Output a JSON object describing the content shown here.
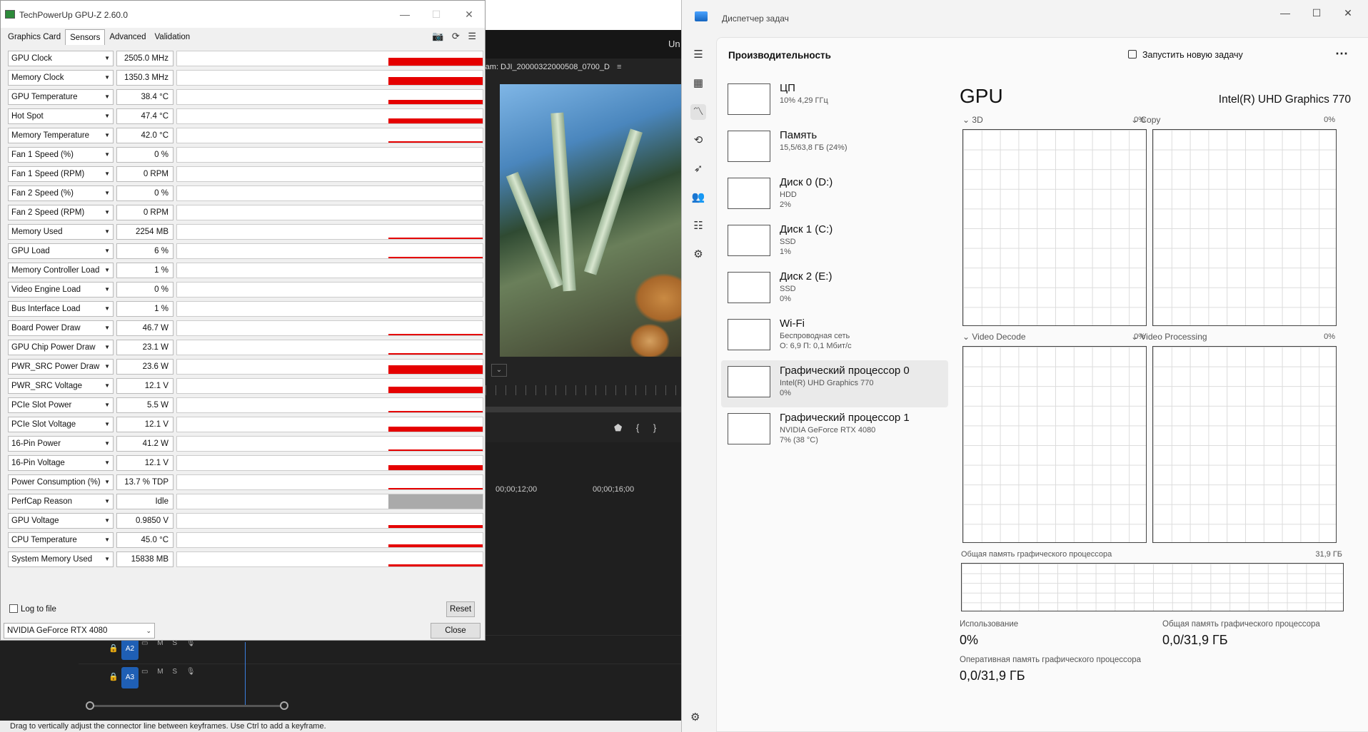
{
  "premiere": {
    "title_fragment": "Un",
    "program_tab": "ram: DJI_20000322000508_0700_D",
    "program_menu": "≡",
    "marker_buttons": "⬟ { }",
    "timecodes": [
      "00;00;12;00",
      "00;00;16;00"
    ],
    "track_labels": [
      "A2",
      "A3"
    ],
    "track_controls": "M S",
    "status_bar": "Drag to vertically adjust the connector line between keyframes. Use Ctrl to add a keyframe."
  },
  "gpuz": {
    "title": "TechPowerUp GPU-Z 2.60.0",
    "tabs": [
      "Graphics Card",
      "Sensors",
      "Advanced",
      "Validation"
    ],
    "active_tab": "Sensors",
    "sensors": [
      {
        "name": "GPU Clock",
        "value": "2505.0 MHz",
        "level": 0.55
      },
      {
        "name": "Memory Clock",
        "value": "1350.3 MHz",
        "level": 0.55
      },
      {
        "name": "GPU Temperature",
        "value": "38.4 °C",
        "level": 0.3
      },
      {
        "name": "Hot Spot",
        "value": "47.4 °C",
        "level": 0.35
      },
      {
        "name": "Memory Temperature",
        "value": "42.0 °C",
        "level": 0.12
      },
      {
        "name": "Fan 1 Speed (%)",
        "value": "0 %",
        "level": 0
      },
      {
        "name": "Fan 1 Speed (RPM)",
        "value": "0 RPM",
        "level": 0
      },
      {
        "name": "Fan 2 Speed (%)",
        "value": "0 %",
        "level": 0
      },
      {
        "name": "Fan 2 Speed (RPM)",
        "value": "0 RPM",
        "level": 0
      },
      {
        "name": "Memory Used",
        "value": "2254 MB",
        "level": 0.1
      },
      {
        "name": "GPU Load",
        "value": "6 %",
        "level": 0.06
      },
      {
        "name": "Memory Controller Load",
        "value": "1 %",
        "level": 0
      },
      {
        "name": "Video Engine Load",
        "value": "0 %",
        "level": 0
      },
      {
        "name": "Bus Interface Load",
        "value": "1 %",
        "level": 0
      },
      {
        "name": "Board Power Draw",
        "value": "46.7 W",
        "level": 0.1
      },
      {
        "name": "GPU Chip Power Draw",
        "value": "23.1 W",
        "level": 0.1
      },
      {
        "name": "PWR_SRC Power Draw",
        "value": "23.6 W",
        "level": 0.6
      },
      {
        "name": "PWR_SRC Voltage",
        "value": "12.1 V",
        "level": 0.45
      },
      {
        "name": "PCIe Slot Power",
        "value": "5.5 W",
        "level": 0.08
      },
      {
        "name": "PCIe Slot Voltage",
        "value": "12.1 V",
        "level": 0.35
      },
      {
        "name": "16-Pin Power",
        "value": "41.2 W",
        "level": 0.1
      },
      {
        "name": "16-Pin Voltage",
        "value": "12.1 V",
        "level": 0.35
      },
      {
        "name": "Power Consumption (%)",
        "value": "13.7 % TDP",
        "level": 0.1
      },
      {
        "name": "PerfCap Reason",
        "value": "Idle",
        "level": 1.0,
        "gray": true
      },
      {
        "name": "GPU Voltage",
        "value": "0.9850 V",
        "level": 0.2
      },
      {
        "name": "CPU Temperature",
        "value": "45.0 °C",
        "level": 0.2
      },
      {
        "name": "System Memory Used",
        "value": "15838 MB",
        "level": 0.15
      }
    ],
    "log_to_file": "Log to file",
    "reset_label": "Reset",
    "close_label": "Close",
    "gpu_selected": "NVIDIA GeForce RTX 4080",
    "graph_color": "#e50000"
  },
  "taskmgr": {
    "title": "Диспетчер задач",
    "page_title": "Производительность",
    "run_new_task": "Запустить новую задачу",
    "resources": [
      {
        "name": "ЦП",
        "sub": [
          "10% 4,29 ГГц"
        ]
      },
      {
        "name": "Память",
        "sub": [
          "15,5/63,8 ГБ (24%)"
        ]
      },
      {
        "name": "Диск 0 (D:)",
        "sub": [
          "HDD",
          "2%"
        ]
      },
      {
        "name": "Диск 1 (C:)",
        "sub": [
          "SSD",
          "1%"
        ]
      },
      {
        "name": "Диск 2 (E:)",
        "sub": [
          "SSD",
          "0%"
        ]
      },
      {
        "name": "Wi-Fi",
        "sub": [
          "Беспроводная сеть",
          "О: 6,9 П: 0,1 Мбит/с"
        ]
      },
      {
        "name": "Графический процессор 0",
        "sub": [
          "Intel(R) UHD Graphics 770",
          "0%"
        ]
      },
      {
        "name": "Графический процессор 1",
        "sub": [
          "NVIDIA GeForce RTX 4080",
          "7% (38 °C)"
        ]
      }
    ],
    "selected_resource": "Графический процессор 0",
    "gpu_heading": "GPU",
    "gpu_model": "Intel(R) UHD Graphics 770",
    "engines": [
      {
        "label": "3D",
        "pct": "0%"
      },
      {
        "label": "Copy",
        "pct": "0%"
      },
      {
        "label": "Video Decode",
        "pct": "0%"
      },
      {
        "label": "Video Processing",
        "pct": "0%"
      }
    ],
    "shared_memory_label": "Общая память графического процессора",
    "shared_memory_max": "31,9 ГБ",
    "stats": {
      "usage_label": "Использование",
      "usage_value": "0%",
      "shared_label": "Общая память графического процессора",
      "shared_value": "0,0/31,9 ГБ",
      "ram_label": "Оперативная память графического процессора",
      "ram_value": "0,0/31,9 ГБ"
    }
  }
}
